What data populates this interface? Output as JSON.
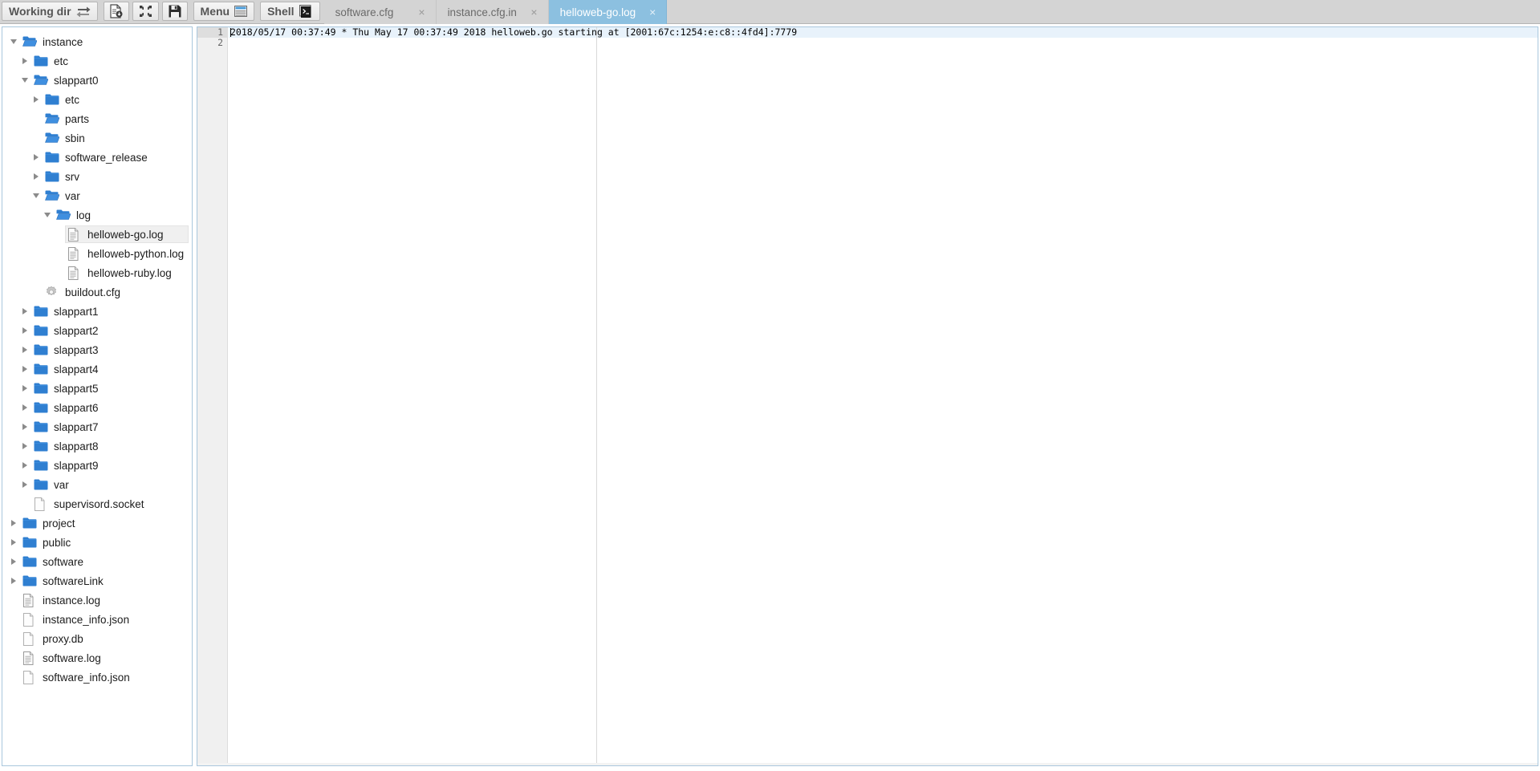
{
  "toolbar": {
    "working_dir_label": "Working dir",
    "working_dir_icon": "swap-arrows-icon",
    "doc_download_icon": "document-save-icon",
    "collapse_icon": "collapse-arrows-icon",
    "save_icon": "floppy-save-icon",
    "menu_label": "Menu",
    "menu_icon": "menu-list-icon",
    "shell_label": "Shell",
    "shell_icon": "terminal-icon",
    "close_glyph": "×"
  },
  "tabs": [
    {
      "label": "software.cfg",
      "active": false
    },
    {
      "label": "instance.cfg.in",
      "active": false
    },
    {
      "label": "helloweb-go.log",
      "active": true
    }
  ],
  "tree": [
    {
      "label": "instance",
      "indent": 0,
      "type": "folder-open",
      "state": "open",
      "selected": false
    },
    {
      "label": "etc",
      "indent": 1,
      "type": "folder-closed",
      "state": "closed",
      "selected": false
    },
    {
      "label": "slappart0",
      "indent": 1,
      "type": "folder-open",
      "state": "open",
      "selected": false
    },
    {
      "label": "etc",
      "indent": 2,
      "type": "folder-closed",
      "state": "closed",
      "selected": false
    },
    {
      "label": "parts",
      "indent": 2,
      "type": "folder-open",
      "state": "leaf",
      "selected": false
    },
    {
      "label": "sbin",
      "indent": 2,
      "type": "folder-open",
      "state": "leaf",
      "selected": false
    },
    {
      "label": "software_release",
      "indent": 2,
      "type": "folder-closed",
      "state": "closed",
      "selected": false
    },
    {
      "label": "srv",
      "indent": 2,
      "type": "folder-closed",
      "state": "closed",
      "selected": false
    },
    {
      "label": "var",
      "indent": 2,
      "type": "folder-open",
      "state": "open",
      "selected": false
    },
    {
      "label": "log",
      "indent": 3,
      "type": "folder-open",
      "state": "open",
      "selected": false
    },
    {
      "label": "helloweb-go.log",
      "indent": 4,
      "type": "file-lines",
      "state": "leaf",
      "selected": true
    },
    {
      "label": "helloweb-python.log",
      "indent": 4,
      "type": "file-lines",
      "state": "leaf",
      "selected": false
    },
    {
      "label": "helloweb-ruby.log",
      "indent": 4,
      "type": "file-lines",
      "state": "leaf",
      "selected": false
    },
    {
      "label": "buildout.cfg",
      "indent": 2,
      "type": "file-cfg",
      "state": "leaf",
      "selected": false
    },
    {
      "label": "slappart1",
      "indent": 1,
      "type": "folder-closed",
      "state": "closed",
      "selected": false
    },
    {
      "label": "slappart2",
      "indent": 1,
      "type": "folder-closed",
      "state": "closed",
      "selected": false
    },
    {
      "label": "slappart3",
      "indent": 1,
      "type": "folder-closed",
      "state": "closed",
      "selected": false
    },
    {
      "label": "slappart4",
      "indent": 1,
      "type": "folder-closed",
      "state": "closed",
      "selected": false
    },
    {
      "label": "slappart5",
      "indent": 1,
      "type": "folder-closed",
      "state": "closed",
      "selected": false
    },
    {
      "label": "slappart6",
      "indent": 1,
      "type": "folder-closed",
      "state": "closed",
      "selected": false
    },
    {
      "label": "slappart7",
      "indent": 1,
      "type": "folder-closed",
      "state": "closed",
      "selected": false
    },
    {
      "label": "slappart8",
      "indent": 1,
      "type": "folder-closed",
      "state": "closed",
      "selected": false
    },
    {
      "label": "slappart9",
      "indent": 1,
      "type": "folder-closed",
      "state": "closed",
      "selected": false
    },
    {
      "label": "var",
      "indent": 1,
      "type": "folder-closed",
      "state": "closed",
      "selected": false
    },
    {
      "label": "supervisord.socket",
      "indent": 1,
      "type": "file-plain",
      "state": "leaf",
      "selected": false
    },
    {
      "label": "project",
      "indent": 0,
      "type": "folder-closed",
      "state": "closed",
      "selected": false
    },
    {
      "label": "public",
      "indent": 0,
      "type": "folder-closed",
      "state": "closed",
      "selected": false
    },
    {
      "label": "software",
      "indent": 0,
      "type": "folder-closed",
      "state": "closed",
      "selected": false
    },
    {
      "label": "softwareLink",
      "indent": 0,
      "type": "folder-closed",
      "state": "closed",
      "selected": false
    },
    {
      "label": "instance.log",
      "indent": 0,
      "type": "file-lines",
      "state": "leaf",
      "selected": false
    },
    {
      "label": "instance_info.json",
      "indent": 0,
      "type": "file-plain",
      "state": "leaf",
      "selected": false
    },
    {
      "label": "proxy.db",
      "indent": 0,
      "type": "file-plain",
      "state": "leaf",
      "selected": false
    },
    {
      "label": "software.log",
      "indent": 0,
      "type": "file-lines",
      "state": "leaf",
      "selected": false
    },
    {
      "label": "software_info.json",
      "indent": 0,
      "type": "file-plain",
      "state": "leaf",
      "selected": false
    }
  ],
  "editor": {
    "line_numbers": [
      "1",
      "2"
    ],
    "lines": [
      "2018/05/17 00:37:49 * Thu May 17 00:37:49 2018 helloweb.go starting at [2001:67c:1254:e:c8::4fd4]:7779",
      ""
    ],
    "cursor_line": 1
  },
  "colors": {
    "active_tab": "#8cc0e0",
    "toolbar_bg": "#d4d4d4",
    "panel_border": "#a9c7dd",
    "folder_blue": "#2f7fd1",
    "active_line": "#e8f2fb"
  }
}
